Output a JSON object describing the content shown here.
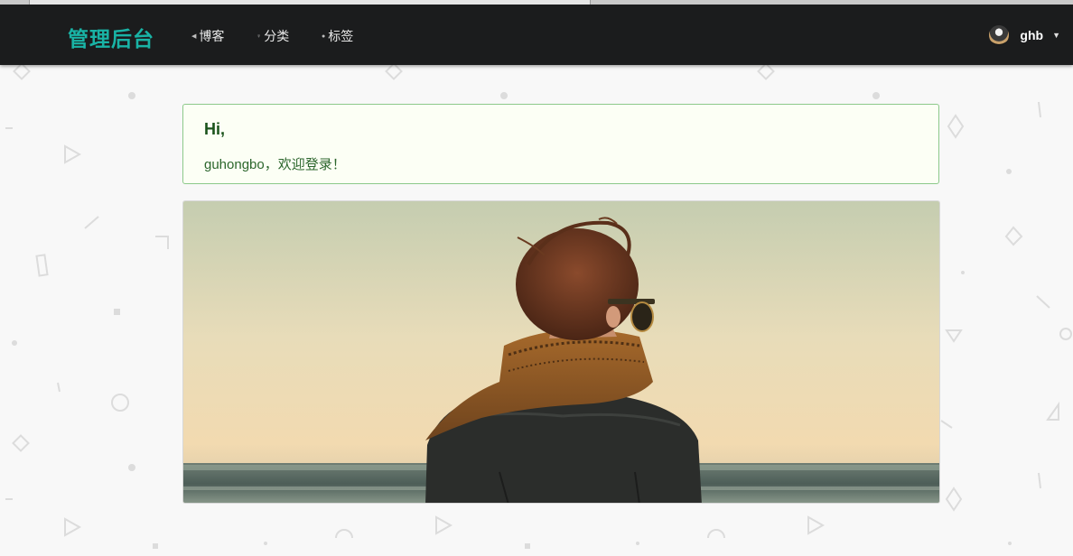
{
  "navbar": {
    "brand": "管理后台",
    "items": [
      {
        "label": "博客",
        "icon": "bullet-icon"
      },
      {
        "label": "分类",
        "icon": "bullet-icon"
      },
      {
        "label": "标签",
        "icon": "bullet-icon"
      }
    ],
    "user": {
      "name": "ghb",
      "avatar": "user-avatar",
      "dropdown_icon": "caret-down-icon"
    }
  },
  "welcome": {
    "greeting": "Hi,",
    "message": "guhongbo，欢迎登录！"
  },
  "photo": {
    "subject": "person-with-scarf-at-seaside"
  },
  "colors": {
    "navbar_bg": "#1b1c1d",
    "brand": "#19b3a5",
    "welcome_bg": "#fcfff5",
    "welcome_border": "#8cc98a",
    "welcome_text": "#2c662d",
    "page_bg": "#f8f8f8"
  }
}
